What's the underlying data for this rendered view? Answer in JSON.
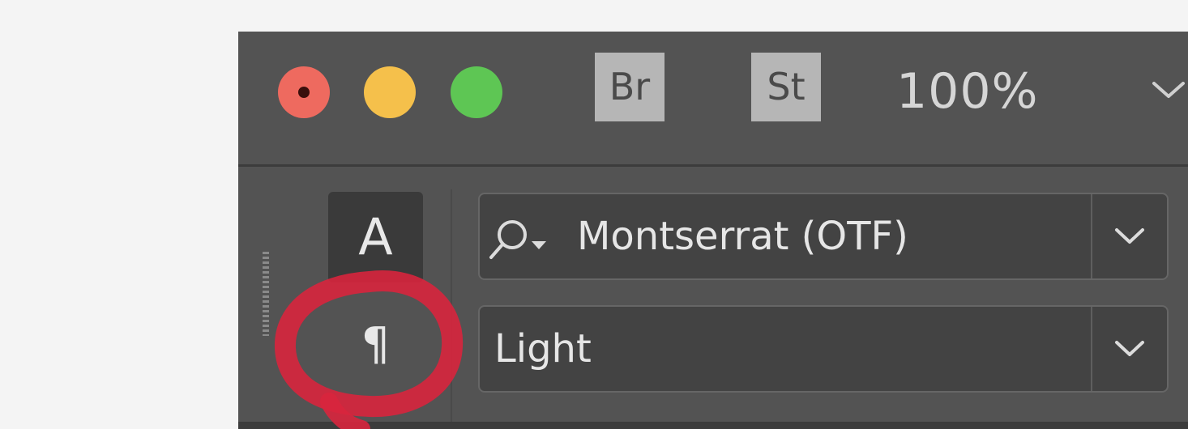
{
  "titlebar": {
    "apps": [
      {
        "label": "Br"
      },
      {
        "label": "St"
      }
    ],
    "zoom": {
      "value": "100%"
    }
  },
  "character_panel": {
    "tabs": {
      "character_label": "A",
      "paragraph_label": "¶"
    },
    "font_family": {
      "value": "Montserrat (OTF)"
    },
    "font_style": {
      "value": "Light"
    }
  },
  "colors": {
    "close": "#ee6a5f",
    "minimize": "#f5c04b",
    "maximize": "#5ec654",
    "annotation": "#d8253d"
  },
  "icons": [
    "search-icon",
    "chevron-down-icon",
    "close-icon",
    "minimize-icon",
    "maximize-icon"
  ]
}
